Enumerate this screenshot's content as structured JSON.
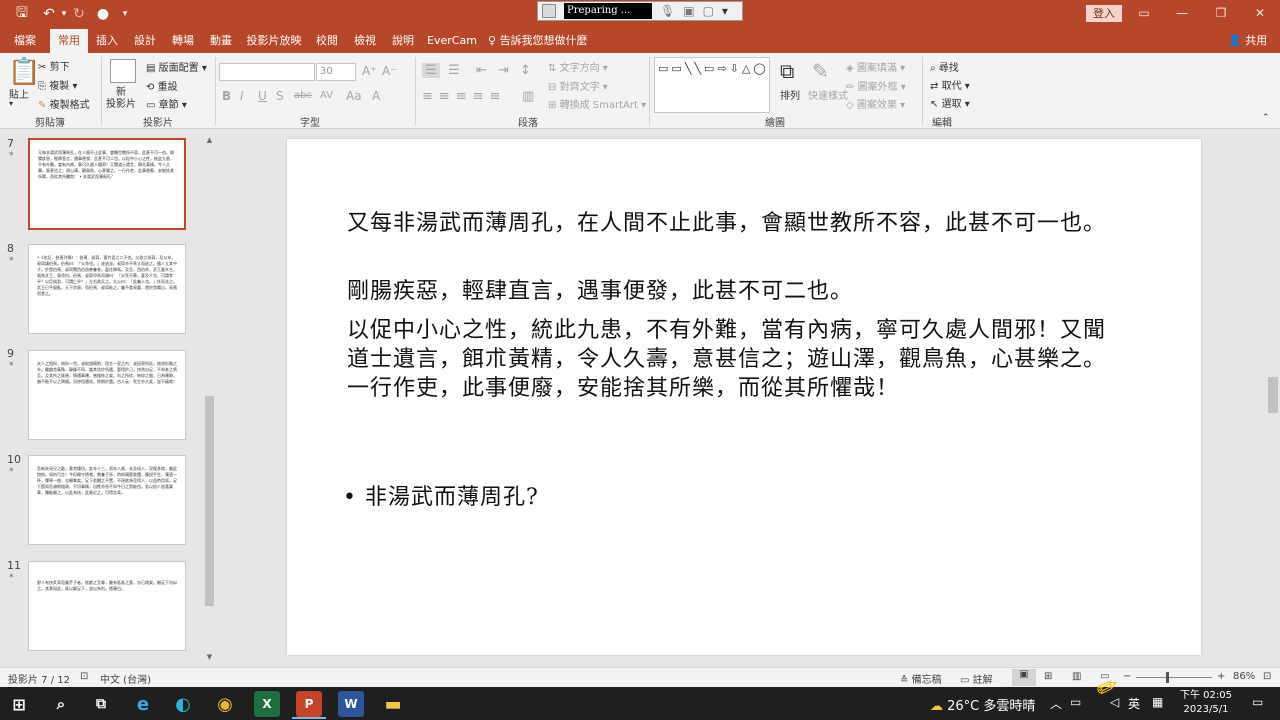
{
  "titlebar": {
    "recorder_status": "Preparing ...",
    "login_label": "登入"
  },
  "tabs": [
    {
      "label": "檔案",
      "active": false
    },
    {
      "label": "常用",
      "active": true
    },
    {
      "label": "插入",
      "active": false
    },
    {
      "label": "設計",
      "active": false
    },
    {
      "label": "轉場",
      "active": false
    },
    {
      "label": "動畫",
      "active": false
    },
    {
      "label": "投影片放映",
      "active": false
    },
    {
      "label": "校閱",
      "active": false
    },
    {
      "label": "檢視",
      "active": false
    },
    {
      "label": "說明",
      "active": false
    },
    {
      "label": "EverCam",
      "active": false
    },
    {
      "label": "告訴我您想做什麼",
      "active": false
    }
  ],
  "share_label": "共用",
  "ribbon": {
    "clipboard": {
      "paste": "貼上",
      "cut": "剪下",
      "copy": "複製",
      "format_painter": "複製格式",
      "group": "剪貼簿"
    },
    "slides": {
      "new_slide": "新\n投影片",
      "layout": "版面配置",
      "reset": "重設",
      "section": "章節",
      "group": "投影片"
    },
    "font": {
      "size": "30",
      "bold": "B",
      "italic": "I",
      "underline": "U",
      "shadow": "S",
      "strike": "abc",
      "group": "字型"
    },
    "paragraph": {
      "text_direction": "文字方向",
      "align_text": "對齊文字",
      "smartart": "轉換成 SmartArt",
      "group": "段落"
    },
    "drawing": {
      "arrange": "排列",
      "quick_styles": "快速樣式",
      "shape_fill": "圖案填滿",
      "shape_outline": "圖案外框",
      "shape_effects": "圖案效果",
      "group": "繪圖"
    },
    "editing": {
      "find": "尋找",
      "replace": "取代",
      "select": "選取",
      "group": "編輯"
    }
  },
  "thumbnails": [
    {
      "num": "7",
      "star": "*",
      "selected": true,
      "text": "又每非湯武而薄周孔，在人間不止此事，會顯世教所不容，此甚不可一也。剛腸疾惡，輕肆直言，遇事便發，此甚不可二也。以促中小心之性，統此九患，不有外難，當有內病，寧可久處人間邪！又聞道士遺言，餌朮黃精，令人久壽，意甚信之；遊山澤，觀鳥魚，心甚樂之。一行作吏，此事便廢，安能捨其所樂，而從其所懼哉！ • 非湯武而薄周孔?"
    },
    {
      "num": "8",
      "star": "*",
      "selected": false,
      "text": "•《史記．伯夷列傳》：伯夷、叔齊，孤竹君之二子也。父欲立叔齊，及父卒，叔齊讓伯夷。伯夷曰：「父命也。」遂逃去。叔齊亦不肯立而逃之。國人立其中子。於是伯夷、叔齊聞西伯昌善養老，盍往歸焉。及至，西伯卒，武王載木主，號為文王，東伐紂。伯夷、叔齊叩馬而諫曰：「父死不葬，爰及干戈，可謂孝乎？以臣弒君，可謂仁乎？」左右欲兵之。太公曰：「此義人也。」扶而去之。武王已平殷亂，天下宗周，而伯夷、叔齊恥之，義不食周粟，隱於首陽山，采薇而食之。"
    },
    {
      "num": "9",
      "star": "*",
      "selected": false,
      "text": "夫人之相與，俯仰一世。或取諸懷抱，悟言一室之內；或因寄所託，放浪形骸之外。雖趣舍萬殊，靜躁不同，當其欣於所遇，暫得於己，快然自足，不知老之將至。及其所之既倦，情隨事遷，感慨係之矣。向之所欣，俯仰之間，已為陳跡，猶不能不以之興懷。況修短隨化，終期於盡。古人云：死生亦大矣，豈不痛哉！"
    },
    {
      "num": "10",
      "star": "*",
      "selected": false,
      "text": "吾新失母兄之歡，意常悽切。女年十三，男年八歲，未及成人，況復多病，顧此悢悢，如何可言！今但願守陋巷，教養子孫，時與親舊敘闊，陳說平生，濁酒一杯，彈琴一曲，志願畢矣。足下若嬲之不置，不過欲為官得人，以益時用耳。足下舊知吾潦倒粗疏，不切事情，自惟亦皆不如今日之賢能也。若以俗人皆喜榮華，獨能離之，以此為快，此最近之，可得言耳。"
    },
    {
      "num": "11",
      "star": "*",
      "selected": false,
      "text": "野人有快炙背而美芹子者，欲獻之至尊，雖有區區之意，亦已疏矣。願足下勿似之。其意如此，既以解足下，並以為別。嵇康白。"
    }
  ],
  "slide": {
    "paragraphs": [
      "又每非湯武而薄周孔，在人間不止此事，會顯世教所不容，此甚不可一也。",
      "剛腸疾惡，輕肆直言，遇事便發，此甚不可二也。",
      "以促中小心之性，統此九患，不有外難，當有內病，寧可久處人間邪！又聞道士遺言，餌朮黃精，令人久壽，意甚信之；遊山澤，觀鳥魚，心甚樂之。一行作吏，此事便廢，安能捨其所樂，而從其所懼哉！"
    ],
    "bullet": "非湯武而薄周孔?"
  },
  "statusbar": {
    "slide_count": "投影片 7 / 12",
    "language": "中文 (台灣)",
    "notes": "備忘稿",
    "comments": "註解",
    "zoom": "86%",
    "zoom_value": 86
  },
  "taskbar": {
    "weather_temp": "26°C",
    "weather_text": "多雲時晴",
    "ime": "英",
    "time": "下午 02:05",
    "date": "2023/5/1"
  }
}
